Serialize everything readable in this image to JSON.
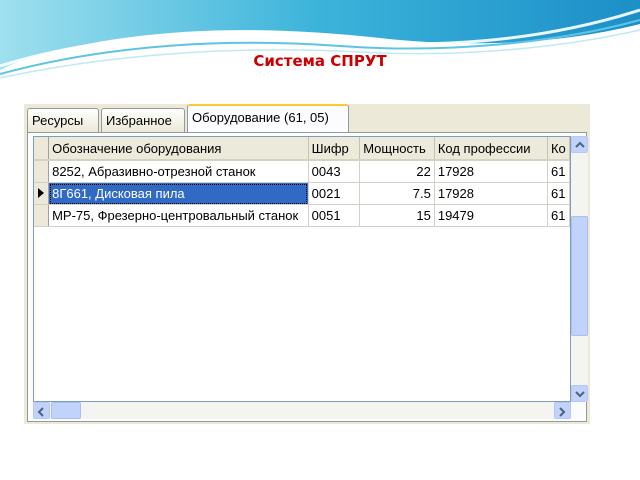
{
  "slide": {
    "title": "Система СПРУТ"
  },
  "tabs": [
    {
      "label": "Ресурсы",
      "active": false
    },
    {
      "label": "Избранное",
      "active": false
    },
    {
      "label": "Оборудование (61, 05)",
      "active": true
    }
  ],
  "grid": {
    "columns": [
      "Обозначение оборудования",
      "Шифр",
      "Мощность",
      "Код профессии",
      "Ко"
    ],
    "rows": [
      {
        "name": "8252, Абразивно-отрезной станок",
        "code": "0043",
        "power": "22",
        "prof": "17928",
        "extra": "61"
      },
      {
        "name": "8Г661, Дисковая пила",
        "code": "0021",
        "power": "7.5",
        "prof": "17928",
        "extra": "61"
      },
      {
        "name": "МР-75, Фрезерно-центровальный станок",
        "code": "0051",
        "power": "15",
        "prof": "19479",
        "extra": "61"
      }
    ],
    "selected_row": 1,
    "row_indicator_icon": "triangle-right-icon"
  },
  "colors": {
    "title": "#cc0000",
    "selection": "#316ac5",
    "active_tab_accent": "#ffc83c",
    "scroll": "#c1d3fb"
  }
}
